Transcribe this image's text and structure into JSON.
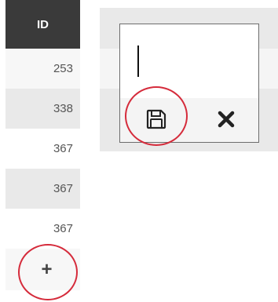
{
  "grid": {
    "id_column_header": "ID",
    "rows": [
      {
        "id": "253"
      },
      {
        "id": "338"
      },
      {
        "id": "367"
      },
      {
        "id": "367"
      },
      {
        "id": "367"
      }
    ],
    "add_label": "+"
  },
  "editor": {
    "input_value": "",
    "save_icon": "floppy-disk-icon",
    "cancel_icon": "close-x-icon"
  },
  "colors": {
    "header_bg": "#3a3a3a",
    "highlight": "#d52b3b"
  }
}
